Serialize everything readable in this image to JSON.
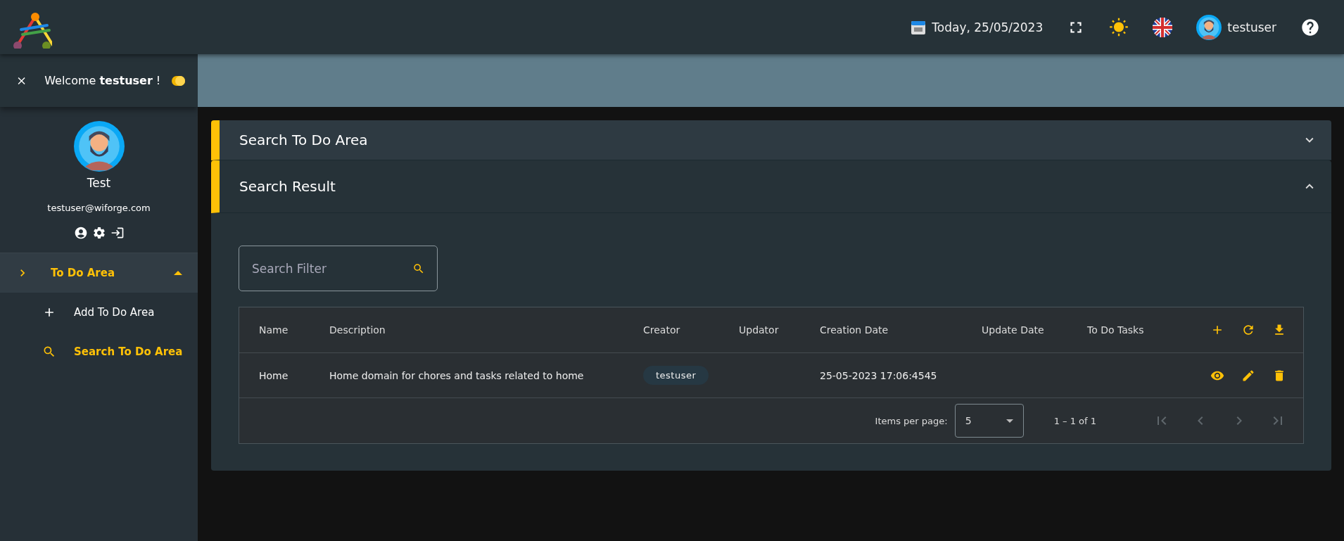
{
  "header": {
    "date": "Today, 25/05/2023",
    "user": "testuser"
  },
  "sidebar": {
    "welcome": "Welcome **testuser** !",
    "toggle_on": true,
    "profile": {
      "name": "Test",
      "email": "testuser@wiforge.com"
    },
    "nav": [
      {
        "label": "To Do Area",
        "selected": true,
        "expanded": true,
        "children": [
          {
            "label": "Add To Do Area",
            "kind": "add",
            "selected": false
          },
          {
            "label": "Search To Do Area",
            "kind": "search",
            "selected": true
          }
        ]
      }
    ]
  },
  "panels": [
    {
      "title": "Search To Do Area",
      "expanded": false
    },
    {
      "title": "Search Result",
      "expanded": true
    }
  ],
  "search": {
    "placeholder": "Search Filter"
  },
  "table": {
    "columns": [
      "Name",
      "Description",
      "Creator",
      "Updator",
      "Creation Date",
      "Update Date",
      "To Do Tasks"
    ],
    "rows": [
      {
        "cells": [
          "Home",
          "Home domain for chores and tasks related to home",
          "testuser",
          "",
          "25-05-2023 17:06:4545",
          "",
          ""
        ]
      }
    ]
  },
  "paginator": {
    "label": "Items per page:",
    "page_size": "5",
    "range": "1 – 1 of 1",
    "buttons": [
      {
        "kind": "first",
        "disabled": true
      },
      {
        "kind": "prev",
        "disabled": true
      },
      {
        "kind": "next",
        "disabled": true
      },
      {
        "kind": "last",
        "disabled": true
      }
    ]
  }
}
